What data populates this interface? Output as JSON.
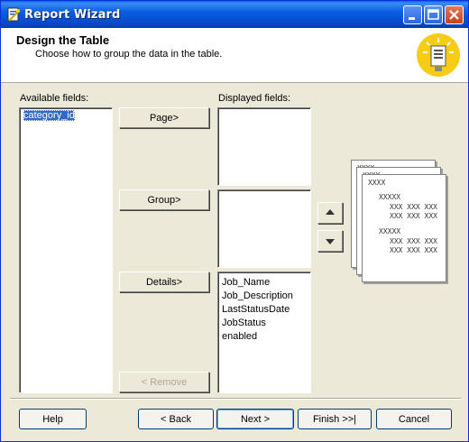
{
  "window": {
    "title": "Report Wizard",
    "icon": "wizard-icon"
  },
  "header": {
    "title": "Design the Table",
    "subtitle": "Choose how to group the data in the table.",
    "badge_icon": "report-bulb-icon"
  },
  "available": {
    "label": "Available fields:",
    "items": [
      "category_id"
    ],
    "selected": "category_id"
  },
  "displayed": {
    "label": "Displayed fields:"
  },
  "buttons": {
    "page": "Page>",
    "group": "Group>",
    "details": "Details>",
    "remove": "< Remove"
  },
  "page_list": {
    "items": []
  },
  "group_list": {
    "items": []
  },
  "details_list": {
    "items": [
      "Job_Name",
      "Job_Description",
      "LastStatusDate",
      "JobStatus",
      "enabled"
    ]
  },
  "preview": {
    "header": "XXXX",
    "group": "XXXXX",
    "detail": "XXX XXX XXX"
  },
  "footer": {
    "help": "Help",
    "back": "< Back",
    "next": "Next >",
    "finish": "Finish >>|",
    "cancel": "Cancel"
  }
}
